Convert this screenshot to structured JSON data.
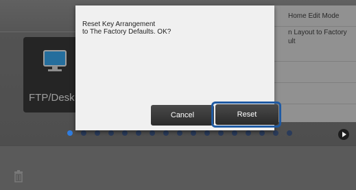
{
  "home": {
    "tile_label": "FTP/Desk",
    "menu": [
      "Home Edit Mode",
      "n Layout to Factory\nult",
      "",
      ""
    ],
    "page_dots": 17,
    "active_dot": 0
  },
  "dialog": {
    "message": "Reset Key Arrangement\nto The Factory Defaults. OK?",
    "cancel_label": "Cancel",
    "reset_label": "Reset"
  },
  "colors": {
    "highlight": "#1f5aa3",
    "active_dot": "#2f7de0"
  }
}
